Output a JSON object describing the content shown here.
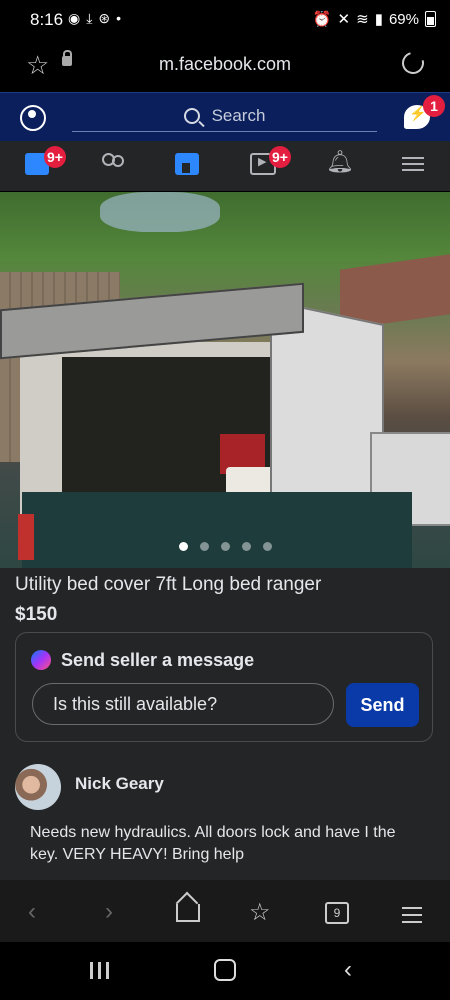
{
  "status_bar": {
    "time": "8:16",
    "left_icons": [
      "messenger-icon",
      "download-icon",
      "vpn-icon",
      "dot-icon"
    ],
    "battery": "69%"
  },
  "browser": {
    "url": "m.facebook.com"
  },
  "fb_header": {
    "search_placeholder": "Search",
    "messenger_badge": "1"
  },
  "fb_tabs": [
    {
      "name": "news-feed",
      "badge": "9+"
    },
    {
      "name": "friends",
      "badge": ""
    },
    {
      "name": "marketplace",
      "badge": ""
    },
    {
      "name": "watch",
      "badge": "9+"
    },
    {
      "name": "notifications",
      "badge": ""
    },
    {
      "name": "menu",
      "badge": ""
    }
  ],
  "listing": {
    "title": "Utility bed cover 7ft Long bed ranger",
    "price": "$150",
    "photo_count": 5,
    "message_box": {
      "title": "Send seller a message",
      "input_value": "Is this still available?",
      "send_label": "Send"
    },
    "seller": {
      "name": "Nick Geary"
    },
    "description": "Needs new hydraulics. All doors lock and have I the key. VERY HEAVY! Bring help"
  },
  "browser_toolbar": {
    "tab_count": "9"
  },
  "colors": {
    "fb_header_bg": "#0a1f5c",
    "badge_red": "#e41e3f",
    "fb_blue": "#2d88ff",
    "send_button": "#0a3aa8",
    "content_bg": "#242526"
  }
}
